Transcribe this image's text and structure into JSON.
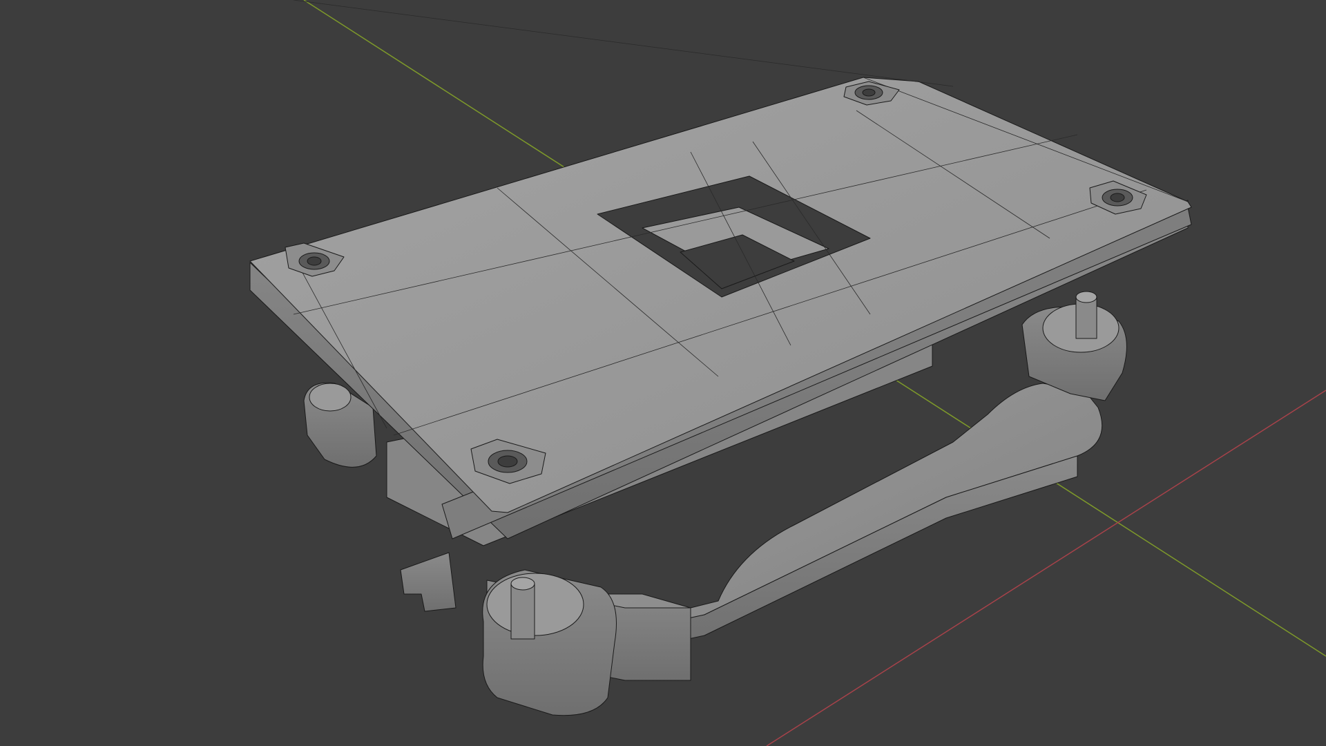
{
  "app": {
    "name": "3D viewport",
    "background_color": "#3d3d3d"
  },
  "viewport": {
    "mode": "wireframe-over-solid",
    "axes": {
      "x_axis_color": "#a8424a",
      "y_axis_color": "#7e9a2a"
    },
    "object": {
      "description_icon": "mesh-object",
      "surface_color": "#9a9a9a",
      "wire_color": "#1a1a1a"
    }
  }
}
